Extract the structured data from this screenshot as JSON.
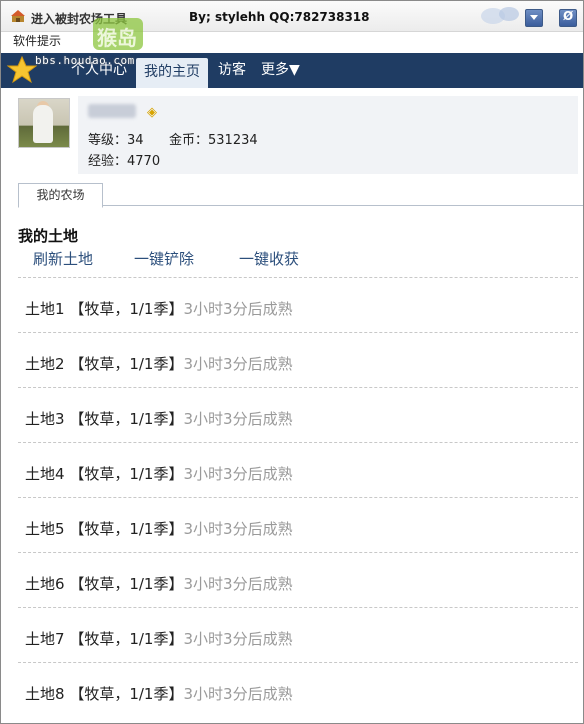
{
  "window": {
    "title": "进入被封农场工具",
    "author": "By; stylehh QQ:782738318",
    "tip": "软件提示",
    "watermark": "bbs.houdao.com",
    "badge": "猴岛"
  },
  "nav": {
    "items": [
      {
        "label": "个人中心"
      },
      {
        "label": "我的主页"
      },
      {
        "label": "访客"
      },
      {
        "label": "更多▼"
      }
    ]
  },
  "profile": {
    "level_label": "等级：",
    "level": "34",
    "gold_label": "金币：",
    "gold": "531234",
    "exp_label": "经验：",
    "exp": "4770"
  },
  "tabs": {
    "my_farm": "我的农场"
  },
  "land": {
    "title": "我的土地",
    "actions": {
      "refresh": "刷新土地",
      "clear": "一键铲除",
      "harvest": "一键收获"
    },
    "plots": [
      {
        "name": "土地1",
        "crop": "【牧草，1/1季】",
        "status": "3小时3分后成熟"
      },
      {
        "name": "土地2",
        "crop": "【牧草，1/1季】",
        "status": "3小时3分后成熟"
      },
      {
        "name": "土地3",
        "crop": "【牧草，1/1季】",
        "status": "3小时3分后成熟"
      },
      {
        "name": "土地4",
        "crop": "【牧草，1/1季】",
        "status": "3小时3分后成熟"
      },
      {
        "name": "土地5",
        "crop": "【牧草，1/1季】",
        "status": "3小时3分后成熟"
      },
      {
        "name": "土地6",
        "crop": "【牧草，1/1季】",
        "status": "3小时3分后成熟"
      },
      {
        "name": "土地7",
        "crop": "【牧草，1/1季】",
        "status": "3小时3分后成熟"
      },
      {
        "name": "土地8",
        "crop": "【牧草，1/1季】",
        "status": "3小时3分后成熟"
      }
    ]
  },
  "colors": {
    "nav_bg": "#1f3c63",
    "link": "#2c4f7c",
    "muted": "#9a9a9a"
  },
  "icons": {
    "app": "farm-app-icon",
    "minimize": "minimize-icon",
    "close": "close-icon",
    "vip": "vip-badge-icon"
  }
}
